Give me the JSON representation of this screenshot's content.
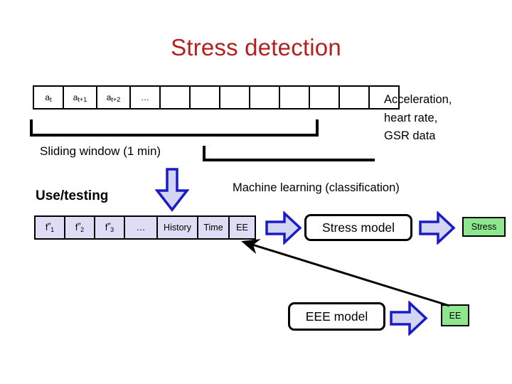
{
  "title": "Stress detection",
  "colors": {
    "title": "#B32020",
    "arrow_stroke": "#1A1AC8",
    "arrow_fill": "#D2D6F2",
    "badge_green": "#8EE68E",
    "cell_fill": "#DDDDF5",
    "line": "#000000"
  },
  "sensor_row": {
    "name": "raw-sensor-sample-row",
    "cells": [
      {
        "label": "a",
        "sub": "t",
        "width": 42
      },
      {
        "label": "a",
        "sub": "t+1",
        "width": 47
      },
      {
        "label": "a",
        "sub": "t+2",
        "width": 47
      },
      {
        "label": "…",
        "sub": "",
        "width": 42
      },
      {
        "label": "",
        "sub": "",
        "width": 42
      },
      {
        "label": "",
        "sub": "",
        "width": 42
      },
      {
        "label": "",
        "sub": "",
        "width": 42
      },
      {
        "label": "",
        "sub": "",
        "width": 42
      },
      {
        "label": "",
        "sub": "",
        "width": 42
      },
      {
        "label": "",
        "sub": "",
        "width": 42
      },
      {
        "label": "",
        "sub": "",
        "width": 42
      },
      {
        "label": "",
        "sub": "",
        "width": 40
      }
    ]
  },
  "sensor_caption": {
    "line1": "Acceleration,",
    "line2": "heart rate,",
    "line3": "GSR data"
  },
  "labels": {
    "sliding_window": "Sliding window (1 min)",
    "use_testing": "Use/testing",
    "machine_learning": "Machine learning (classification)"
  },
  "feature_row": {
    "name": "feature-vector-row",
    "cells": [
      {
        "label": "f",
        "prime": "″",
        "sub": "1",
        "width": 42
      },
      {
        "label": "f",
        "prime": "″",
        "sub": "2",
        "width": 42
      },
      {
        "label": "f",
        "prime": "″",
        "sub": "3",
        "width": 42
      },
      {
        "label": "…",
        "prime": "",
        "sub": "",
        "width": 46
      },
      {
        "label": "History",
        "prime": "",
        "sub": "",
        "width": 57
      },
      {
        "label": "Time",
        "prime": "",
        "sub": "",
        "width": 44
      },
      {
        "label": "EE",
        "prime": "",
        "sub": "",
        "width": 35
      }
    ]
  },
  "models": {
    "stress_model": "Stress model",
    "eee_model": "EEE model"
  },
  "outputs": {
    "stress": "Stress",
    "ee": "EE"
  },
  "icons": {
    "arrow_down": "arrow-down-icon",
    "arrow_right": "arrow-right-icon",
    "feedback": "feedback-arrow-icon"
  }
}
